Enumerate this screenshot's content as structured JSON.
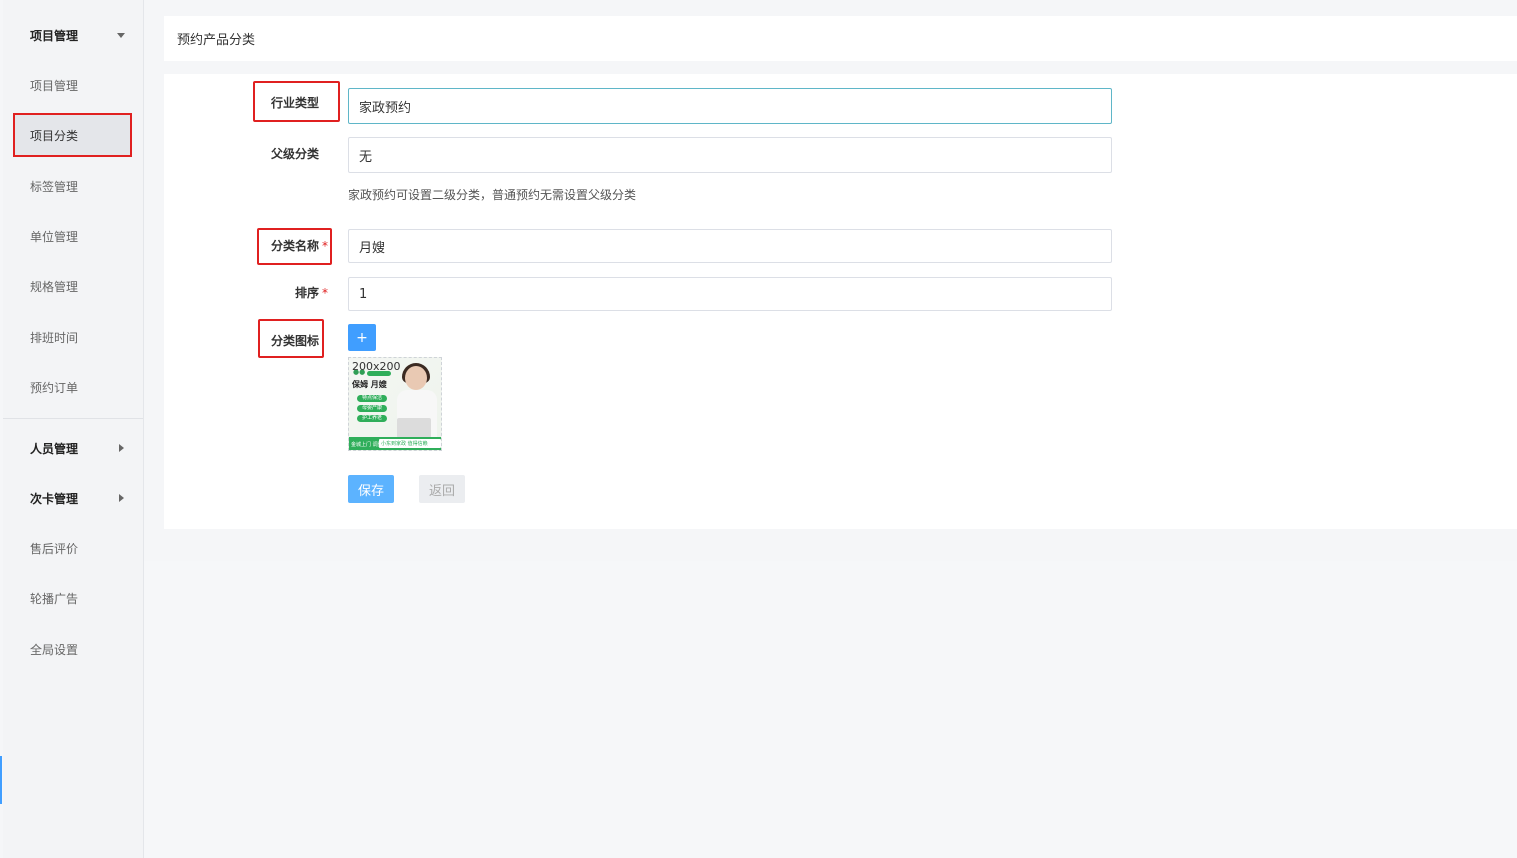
{
  "sidebar": {
    "groups": [
      {
        "label": "项目管理"
      },
      {
        "label": "人员管理"
      },
      {
        "label": "次卡管理"
      }
    ],
    "items": [
      {
        "label": "项目管理"
      },
      {
        "label": "项目分类"
      },
      {
        "label": "标签管理"
      },
      {
        "label": "单位管理"
      },
      {
        "label": "规格管理"
      },
      {
        "label": "排班时间"
      },
      {
        "label": "预约订单"
      },
      {
        "label": "售后评价"
      },
      {
        "label": "轮播广告"
      },
      {
        "label": "全局设置"
      }
    ]
  },
  "header": {
    "title": "预约产品分类"
  },
  "form": {
    "industry_label": "行业类型",
    "industry_value": "家政预约",
    "parent_label": "父级分类",
    "parent_value": "无",
    "hint": "家政预约可设置二级分类，普通预约无需设置父级分类",
    "name_label": "分类名称",
    "name_value": "月嫂",
    "sort_label": "排序",
    "sort_value": "1",
    "icon_label": "分类图标",
    "required_mark": "*",
    "add_label": "+",
    "thumb_size": "200x200",
    "thumb_headline": "保姆 月嫂",
    "thumb_pills": [
      "特点保洁",
      "母婴产康",
      "护工养老"
    ],
    "thumb_bottom_left": "金城上门 调整在市",
    "thumb_bottom_right": "小东到家政  值得信赖",
    "save_label": "保存",
    "back_label": "返回"
  },
  "colors": {
    "accent": "#409eff",
    "highlight": "#e02020",
    "brand_green": "#2fae5a"
  }
}
